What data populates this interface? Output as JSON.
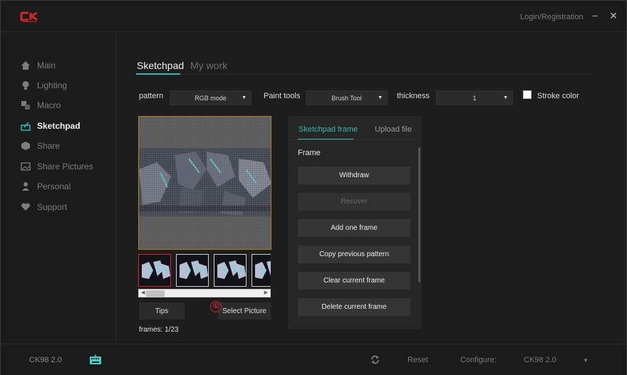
{
  "app": {
    "logo_text": "CK",
    "login_label": "Login/Registration",
    "minimize_label": "−",
    "close_label": "✕"
  },
  "sidebar": {
    "items": [
      {
        "label": "Main",
        "icon": "home-icon"
      },
      {
        "label": "Lighting",
        "icon": "bulb-icon"
      },
      {
        "label": "Macro",
        "icon": "macro-icon"
      },
      {
        "label": "Sketchpad",
        "icon": "sketchpad-icon",
        "active": true
      },
      {
        "label": "Share",
        "icon": "share-cube-icon"
      },
      {
        "label": "Share Pictures",
        "icon": "picture-icon"
      },
      {
        "label": "Personal",
        "icon": "person-icon"
      },
      {
        "label": "Support",
        "icon": "heart-icon"
      }
    ]
  },
  "tabs": {
    "sketchpad": "Sketchpad",
    "my_work": "My work"
  },
  "toolbar": {
    "pattern_label": "pattern",
    "pattern_value": "RGB mode",
    "paint_tools_label": "Paint tools",
    "paint_tools_value": "Brush Tool",
    "thickness_label": "thickness",
    "thickness_value": "1",
    "stroke_color_label": "Stroke color",
    "stroke_color_checked": false
  },
  "editor": {
    "tips_label": "Tips",
    "select_picture_label": "Select Picture",
    "badge_number": "①",
    "frames_text": "frames: 1/23"
  },
  "panel": {
    "tab_frame": "Sketchpad frame",
    "tab_upload": "Upload file",
    "section_title": "Frame",
    "buttons": [
      {
        "label": "Withdraw",
        "enabled": true
      },
      {
        "label": "Recover",
        "enabled": false
      },
      {
        "label": "Add one frame",
        "enabled": true
      },
      {
        "label": "Copy previous pattern",
        "enabled": true
      },
      {
        "label": "Clear current frame",
        "enabled": true
      },
      {
        "label": "Delete current frame",
        "enabled": true
      }
    ]
  },
  "footer": {
    "device_name": "CK98 2.0",
    "reset_label": "Reset",
    "configure_label": "Configure:",
    "configure_value": "CK98 2.0"
  },
  "colors": {
    "accent": "#2fb9b0",
    "brand_red": "#d0262d",
    "canvas_border": "#b07a1b"
  }
}
